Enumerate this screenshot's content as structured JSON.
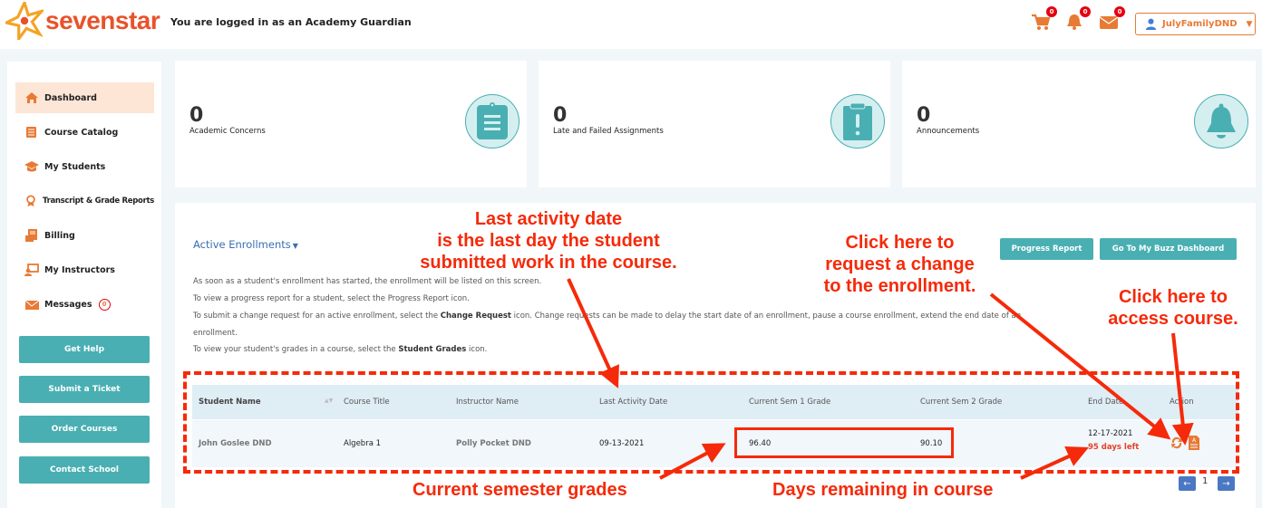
{
  "header": {
    "logo_text": "sevenstar",
    "logged_in_text": "You are logged in as an Academy Guardian",
    "cart_badge": "0",
    "notifications_badge": "0",
    "messages_badge": "0",
    "user_name": "JulyFamilyDND"
  },
  "sidebar": {
    "items": [
      {
        "label": "Dashboard",
        "icon": "home-icon",
        "active": true
      },
      {
        "label": "Course Catalog",
        "icon": "book-icon"
      },
      {
        "label": "My Students",
        "icon": "graduation-cap-icon"
      },
      {
        "label": "Transcript & Grade Reports",
        "icon": "award-icon"
      },
      {
        "label": "Billing",
        "icon": "billing-icon"
      },
      {
        "label": "My Instructors",
        "icon": "instructor-icon"
      },
      {
        "label": "Messages",
        "icon": "envelope-icon",
        "badge": "0"
      }
    ],
    "buttons": [
      "Get Help",
      "Submit a Ticket",
      "Order Courses",
      "Contact School"
    ]
  },
  "stats": [
    {
      "value": "0",
      "label": "Academic Concerns",
      "icon": "clipboard-list-icon"
    },
    {
      "value": "0",
      "label": "Late and Failed Assignments",
      "icon": "clipboard-alert-icon"
    },
    {
      "value": "0",
      "label": "Announcements",
      "icon": "bell-icon"
    }
  ],
  "enrollments": {
    "title": "Active Enrollments",
    "progress_report_label": "Progress Report",
    "buzz_dashboard_label": "Go To My Buzz Dashboard",
    "info": {
      "line1": "As soon as a student's enrollment has started, the enrollment will be listed on this screen.",
      "line2": "To view a progress report for a student, select the Progress Report icon.",
      "line3a": "To submit a change request for an active enrollment, select the ",
      "line3b": "Change Request",
      "line3c": " icon. Change requests can be made to delay the start date of an enrollment, pause a course enrollment, extend the end date of an",
      "line4": "enrollment.",
      "line5a": "To view your student's grades in a course, select the ",
      "line5b": "Student Grades",
      "line5c": " icon."
    },
    "columns": [
      "Student Name",
      "Course Title",
      "Instructor Name",
      "Last Activity Date",
      "Current Sem 1 Grade",
      "Current Sem 2 Grade",
      "End Date",
      "Action"
    ],
    "rows": [
      {
        "student": "John Goslee DND",
        "course": "Algebra 1",
        "instructor": "Polly Pocket DND",
        "last_activity": "09-13-2021",
        "sem1": "96.40",
        "sem2": "90.10",
        "end_date": "12-17-2021",
        "days_left": "95 days left"
      }
    ],
    "page": "1"
  },
  "annotations": {
    "last_activity_1": "Last activity date",
    "last_activity_2": "is the last day the student",
    "last_activity_3": "submitted work in the course.",
    "change_1": "Click here to",
    "change_2": "request a change",
    "change_3": "to the enrollment.",
    "access_1": "Click here to",
    "access_2": "access course.",
    "grades": "Current semester grades",
    "days": "Days remaining in course"
  },
  "colors": {
    "brand_orange": "#e87a35",
    "teal": "#4aafb2",
    "annotation_red": "#f52a0a",
    "link_blue": "#3a6fb0"
  }
}
